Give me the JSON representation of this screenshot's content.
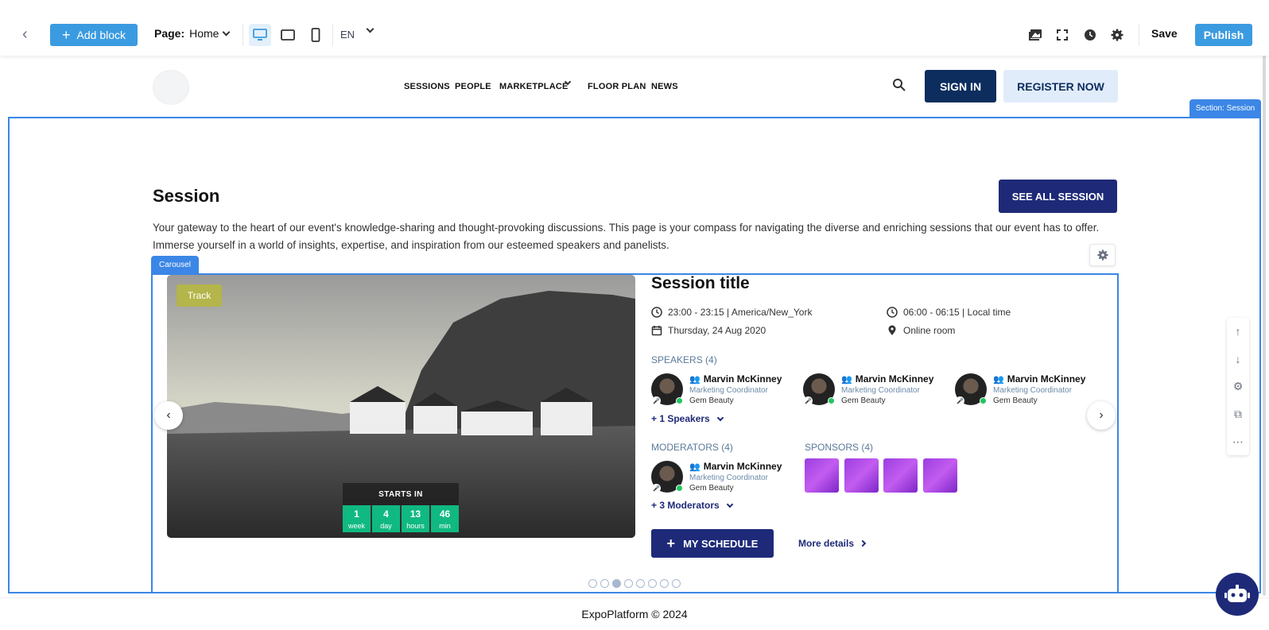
{
  "toolbar": {
    "add_block_label": "Add block",
    "page_label": "Page:",
    "page_value": "Home",
    "language": "EN",
    "save_label": "Save",
    "publish_label": "Publish"
  },
  "site_nav": {
    "items": [
      "SESSIONS",
      "PEOPLE",
      "MARKETPLACE",
      "FLOOR PLAN",
      "NEWS"
    ],
    "sign_in": "SIGN IN",
    "register": "REGISTER NOW"
  },
  "section": {
    "tag": "Section: Session",
    "title": "Session",
    "see_all": "SEE ALL SESSION",
    "description": "Your gateway to the heart of our event's knowledge-sharing and thought-provoking discussions. This page is your compass for navigating the diverse and enriching sessions that our event has to offer. Immerse yourself in a world of insights, expertise, and inspiration from our esteemed speakers and panelists."
  },
  "carousel": {
    "tag": "Carousel",
    "track_badge": "Track",
    "starts_in_label": "STARTS IN",
    "countdown": [
      {
        "num": "1",
        "unit": "week"
      },
      {
        "num": "4",
        "unit": "day"
      },
      {
        "num": "13",
        "unit": "hours"
      },
      {
        "num": "46",
        "unit": "min"
      }
    ],
    "session_title": "Session title",
    "time_event": "23:00 - 23:15 | America/New_York",
    "time_local": "06:00 - 06:15 | Local time",
    "date": "Thursday, 24 Aug 2020",
    "location": "Online room",
    "speakers_heading": "SPEAKERS (4)",
    "speakers": [
      {
        "name": "Marvin McKinney",
        "role": "Marketing Coordinator",
        "company": "Gem Beauty"
      },
      {
        "name": "Marvin McKinney",
        "role": "Marketing Coordinator",
        "company": "Gem Beauty"
      },
      {
        "name": "Marvin McKinney",
        "role": "Marketing Coordinator",
        "company": "Gem Beauty"
      }
    ],
    "more_speakers": "+ 1 Speakers",
    "moderators_heading": "MODERATORS (4)",
    "moderator": {
      "name": "Marvin McKinney",
      "role": "Marketing Coordinator",
      "company": "Gem Beauty"
    },
    "more_moderators": "+ 3 Moderators",
    "sponsors_heading": "SPONSORS (4)",
    "my_schedule": "MY SCHEDULE",
    "more_details": "More details",
    "active_slide": 3,
    "slide_count": 8
  },
  "footer": {
    "text": "ExpoPlatform © 2024"
  },
  "colors": {
    "accent": "#3b9be0",
    "navy": "#1e2a78",
    "frame": "#3b86e6",
    "countdown": "#10b981"
  }
}
